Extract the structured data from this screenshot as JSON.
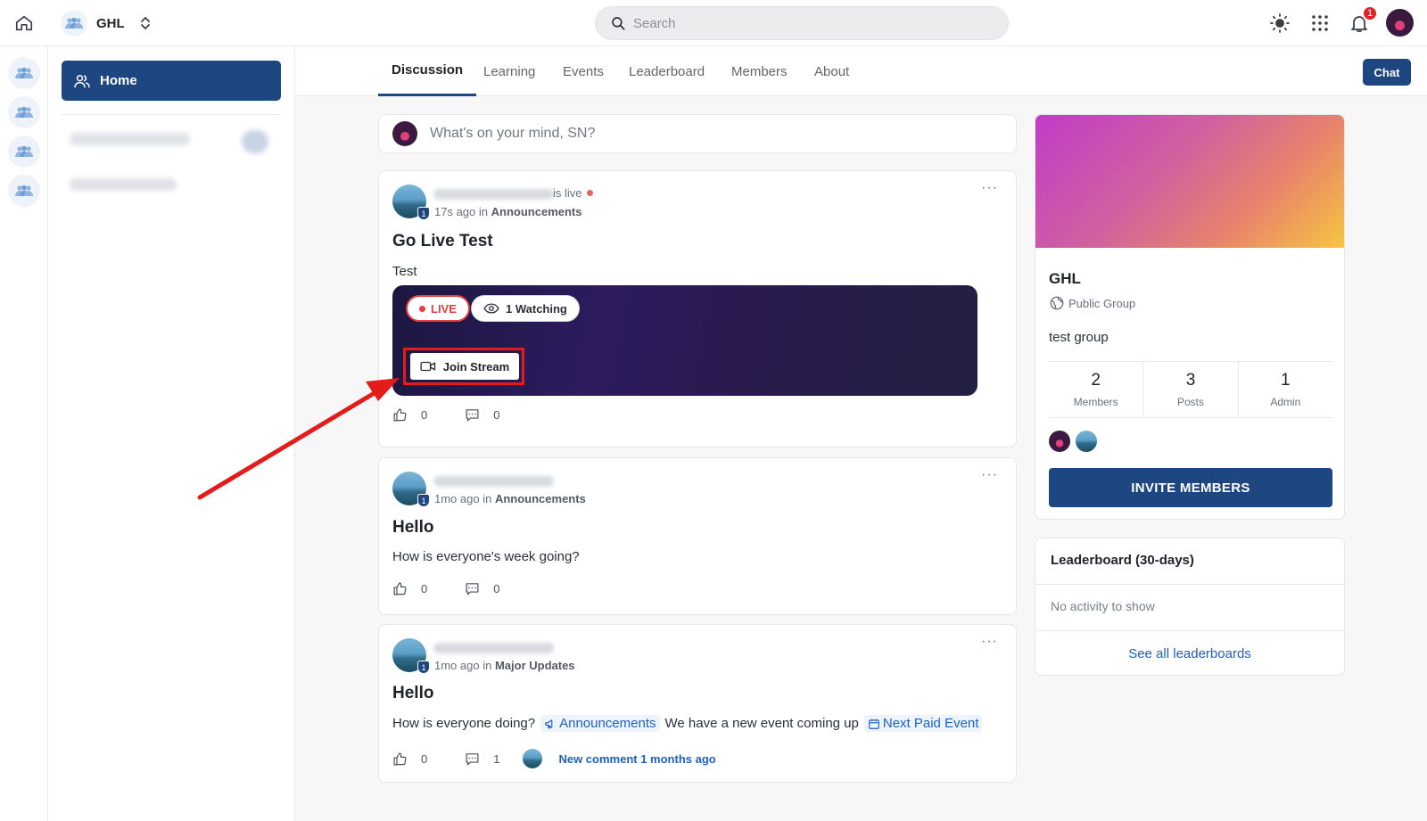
{
  "header": {
    "brand_name": "GHL",
    "search_placeholder": "Search",
    "notification_count": "1"
  },
  "sidenav": {
    "home_label": "Home"
  },
  "tabs": [
    {
      "label": "Discussion",
      "active": true
    },
    {
      "label": "Learning"
    },
    {
      "label": "Events"
    },
    {
      "label": "Leaderboard"
    },
    {
      "label": "Members"
    },
    {
      "label": "About"
    }
  ],
  "chat_label": "Chat",
  "composer_placeholder": "What's on your mind, SN?",
  "posts": [
    {
      "live_label": "is live",
      "time": "17s ago",
      "in_word": "in",
      "channel": "Announcements",
      "title": "Go Live Test",
      "body": "Test",
      "stream": {
        "live_badge": "LIVE",
        "watching": "1 Watching",
        "join_label": "Join Stream"
      },
      "likes": "0",
      "comments": "0"
    },
    {
      "time": "1mo ago",
      "in_word": "in",
      "channel": "Announcements",
      "title": "Hello",
      "body": "How is everyone's week going?",
      "likes": "0",
      "comments": "0"
    },
    {
      "time": "1mo ago",
      "in_word": "in",
      "channel": "Major Updates",
      "title": "Hello",
      "body_part1": "How is everyone doing?",
      "mention_channel": "Announcements",
      "body_part2": "We have a new event coming up",
      "mention_event": "Next Paid Event",
      "likes": "0",
      "comments": "1",
      "new_comment": "New comment 1 months ago"
    }
  ],
  "group": {
    "name": "GHL",
    "type": "Public Group",
    "description": "test group",
    "stats": [
      {
        "value": "2",
        "label": "Members"
      },
      {
        "value": "3",
        "label": "Posts"
      },
      {
        "value": "1",
        "label": "Admin"
      }
    ],
    "invite_label": "INVITE MEMBERS"
  },
  "leaderboard": {
    "title": "Leaderboard (30-days)",
    "empty": "No activity to show",
    "link": "See all leaderboards"
  },
  "colors": {
    "primary": "#1e4781",
    "live": "#e53e3e",
    "link": "#1e5fc2",
    "annotation_red": "#e31b1b"
  }
}
